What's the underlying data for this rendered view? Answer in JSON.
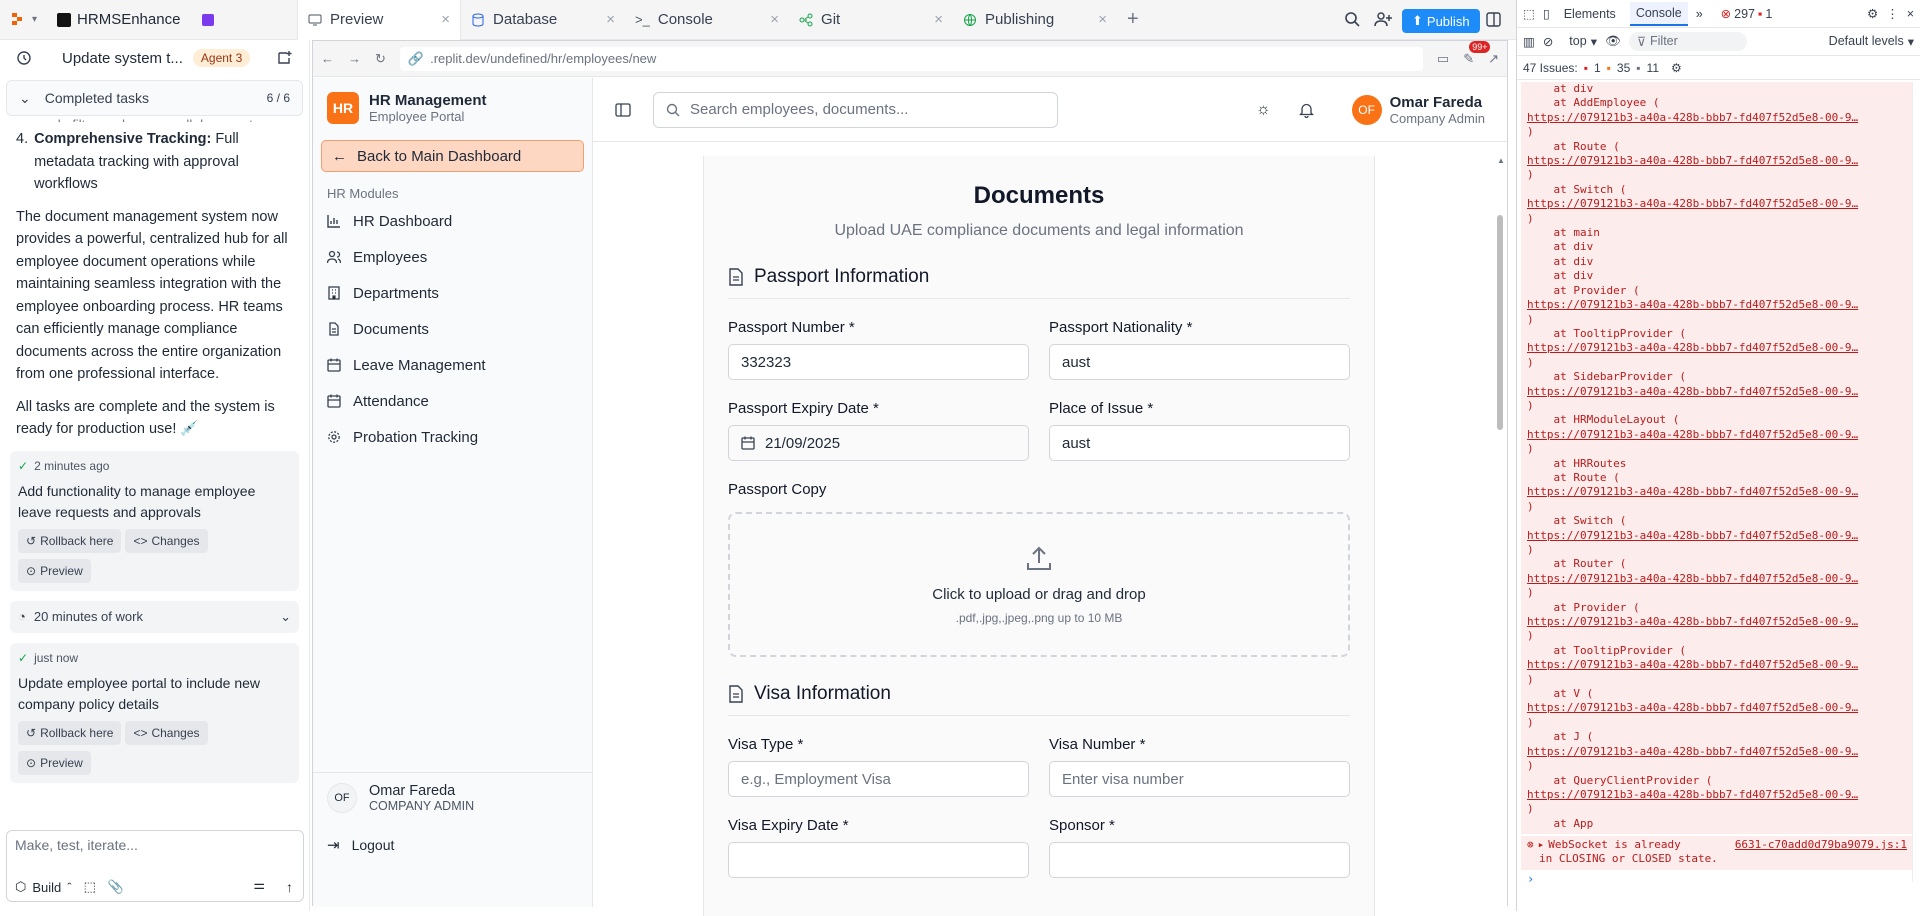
{
  "topbar": {
    "app_name": "HRMSEnhance",
    "tabs": [
      {
        "label": "Preview",
        "icon": "monitor-icon"
      },
      {
        "label": "Database",
        "icon": "database-icon"
      },
      {
        "label": "Console",
        "icon": "terminal-icon"
      },
      {
        "label": "Git",
        "icon": "git-icon"
      },
      {
        "label": "Publishing",
        "icon": "globe-icon"
      }
    ],
    "publish_label": "Publish"
  },
  "agent": {
    "title": "Update system t...",
    "agent_badge": "Agent 3",
    "completed_label": "Completed tasks",
    "completed_count": "6 / 6",
    "partial_line": "search, filter, and manage all documents",
    "list_num": "4.",
    "list_bold": "Comprehensive Tracking:",
    "list_rest": " Full metadata tracking with approval workflows",
    "paragraph1": "The document management system now provides a powerful, centralized hub for all employee document operations while maintaining seamless integration with the employee onboarding process. HR teams can efficiently manage compliance documents across the entire organization from one professional interface.",
    "paragraph2": "All tasks are complete and the system is ready for production use! 💉",
    "checkpoint1": {
      "time": "2 minutes ago",
      "text": "Add functionality to manage employee leave requests and approvals"
    },
    "work_label": "20 minutes of work",
    "checkpoint2": {
      "time": "just now",
      "text": "Update employee portal to include new company policy details"
    },
    "rollback_label": "Rollback here",
    "changes_label": "Changes",
    "preview_label": "Preview",
    "input_placeholder": "Make, test, iterate...",
    "build_label": "Build"
  },
  "browser": {
    "url": ".replit.dev/undefined/hr/employees/new",
    "notif_count": "99+"
  },
  "hr": {
    "logo": "HR",
    "app_title": "HR Management",
    "app_subtitle": "Employee Portal",
    "back_label": "Back to Main Dashboard",
    "modules_label": "HR Modules",
    "nav": [
      {
        "label": "HR Dashboard",
        "icon": "chart-icon"
      },
      {
        "label": "Employees",
        "icon": "users-icon"
      },
      {
        "label": "Departments",
        "icon": "building-icon"
      },
      {
        "label": "Documents",
        "icon": "file-icon"
      },
      {
        "label": "Leave Management",
        "icon": "calendar-icon"
      },
      {
        "label": "Attendance",
        "icon": "calendar-icon"
      },
      {
        "label": "Probation Tracking",
        "icon": "gear-icon"
      }
    ],
    "user_initials": "OF",
    "user_name": "Omar Fareda",
    "user_role_side": "COMPANY ADMIN",
    "user_role": "Company Admin",
    "logout_label": "Logout",
    "search_placeholder": "Search employees, documents..."
  },
  "form": {
    "title": "Documents",
    "subtitle": "Upload UAE compliance documents and legal information",
    "passport_section": "Passport Information",
    "passport_number_label": "Passport Number *",
    "passport_number": "332323",
    "passport_nationality_label": "Passport Nationality *",
    "passport_nationality": "aust",
    "passport_expiry_label": "Passport Expiry Date *",
    "passport_expiry": "21/09/2025",
    "place_issue_label": "Place of Issue *",
    "place_issue": "aust",
    "passport_copy_label": "Passport Copy",
    "upload_text": "Click to upload or drag and drop",
    "upload_hint": ".pdf,.jpg,.jpeg,.png up to 10 MB",
    "visa_section": "Visa Information",
    "visa_type_label": "Visa Type *",
    "visa_type_placeholder": "e.g., Employment Visa",
    "visa_number_label": "Visa Number *",
    "visa_number_placeholder": "Enter visa number",
    "visa_expiry_label": "Visa Expiry Date *",
    "sponsor_label": "Sponsor *"
  },
  "devtools": {
    "tabs": [
      "Elements",
      "Console"
    ],
    "error_count": "297",
    "warn_count": "1",
    "context": "top",
    "filter_placeholder": "Filter",
    "levels": "Default levels",
    "issues_label": "47 Issues:",
    "issues_err": "1",
    "issues_warn": "35",
    "issues_info": "11",
    "link": "https://079121b3-a40a-428b-bbb7-fd407f52d5e8-00-9…",
    "stack": [
      {
        "t": "    at div"
      },
      {
        "t": "    at AddEmployee (",
        "l": true
      },
      {
        "t": "    at Route (",
        "l": true
      },
      {
        "t": "    at Switch (",
        "l": true
      },
      {
        "t": "    at main"
      },
      {
        "t": "    at div"
      },
      {
        "t": "    at div"
      },
      {
        "t": "    at div"
      },
      {
        "t": "    at Provider (",
        "l": true
      },
      {
        "t": "    at TooltipProvider (",
        "l": true
      },
      {
        "t": "    at SidebarProvider (",
        "l": true
      },
      {
        "t": "    at HRModuleLayout (",
        "l": true
      },
      {
        "t": "    at HRRoutes"
      },
      {
        "t": "    at Route (",
        "l": true
      },
      {
        "t": "    at Switch (",
        "l": true
      },
      {
        "t": "    at Router (",
        "l": true
      },
      {
        "t": "    at Provider (",
        "l": true
      },
      {
        "t": "    at TooltipProvider (",
        "l": true
      },
      {
        "t": "    at V (",
        "l": true
      },
      {
        "t": "    at J (",
        "l": true
      },
      {
        "t": "    at QueryClientProvider (",
        "l": true
      },
      {
        "t": "    at App"
      }
    ],
    "ws_msg": "WebSocket is already",
    "ws_msg2": "in CLOSING or CLOSED state.",
    "ws_link": "6631-c70add0d79ba9079.js:1"
  },
  "colors": {
    "accent": "#f97316",
    "publish": "#1d8cf8",
    "error": "#b91c1c"
  }
}
